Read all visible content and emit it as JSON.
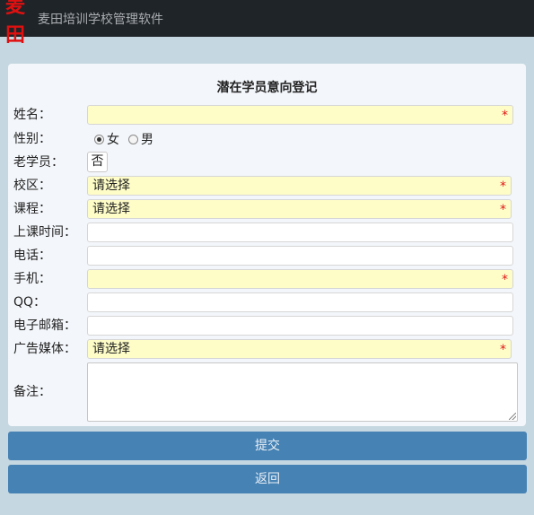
{
  "app": {
    "logo_text": "麦田",
    "title": "麦田培训学校管理软件"
  },
  "form": {
    "title": "潜在学员意向登记",
    "required_mark": "*",
    "fields": {
      "name": {
        "label": "姓名：",
        "value": ""
      },
      "gender": {
        "label": "性别：",
        "options": [
          "女",
          "男"
        ],
        "selected": "女"
      },
      "returning": {
        "label": "老学员：",
        "value": "否"
      },
      "campus": {
        "label": "校区：",
        "value": "请选择"
      },
      "course": {
        "label": "课程：",
        "value": "请选择"
      },
      "class_time": {
        "label": "上课时间：",
        "value": ""
      },
      "phone": {
        "label": "电话：",
        "value": ""
      },
      "mobile": {
        "label": "手机：",
        "value": ""
      },
      "qq": {
        "label": "QQ：",
        "value": ""
      },
      "email": {
        "label": "电子邮箱：",
        "value": ""
      },
      "ad_media": {
        "label": "广告媒体：",
        "value": "请选择"
      },
      "notes": {
        "label": "备注：",
        "value": ""
      }
    }
  },
  "buttons": {
    "submit": "提交",
    "back": "返回"
  }
}
